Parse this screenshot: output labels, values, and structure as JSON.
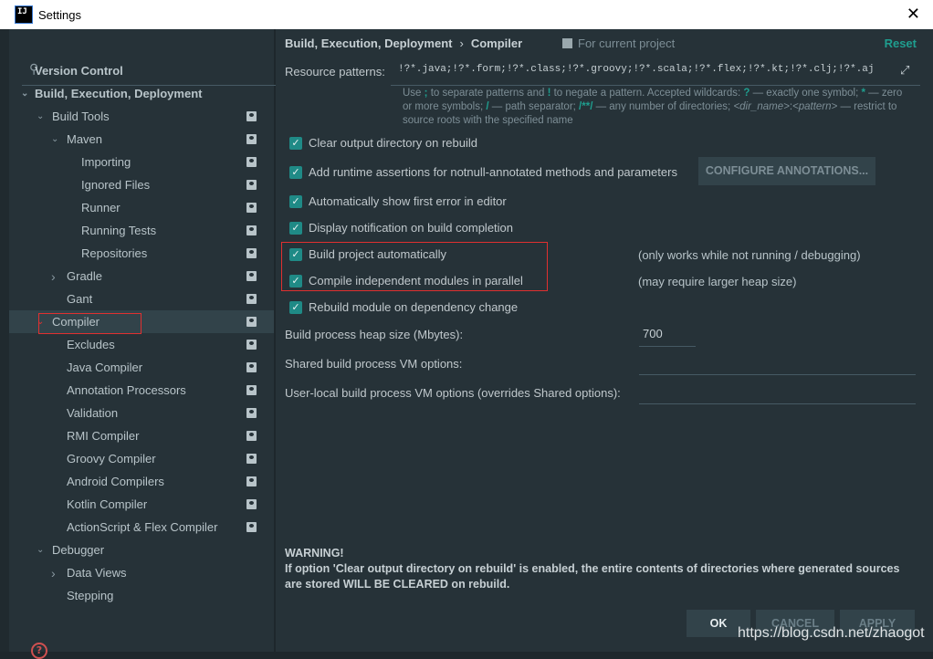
{
  "window": {
    "title": "Settings",
    "logo": "IJ"
  },
  "search": {
    "placeholder": ""
  },
  "tree": [
    {
      "label": "Version Control",
      "level": 0,
      "bold": true,
      "chevron": ""
    },
    {
      "label": "Build, Execution, Deployment",
      "level": 0,
      "bold": true,
      "chevron": "down"
    },
    {
      "label": "Build Tools",
      "level": 1,
      "chevron": "down",
      "proj": true
    },
    {
      "label": "Maven",
      "level": 2,
      "chevron": "down",
      "proj": true
    },
    {
      "label": "Importing",
      "level": 3,
      "proj": true
    },
    {
      "label": "Ignored Files",
      "level": 3,
      "proj": true
    },
    {
      "label": "Runner",
      "level": 3,
      "proj": true
    },
    {
      "label": "Running Tests",
      "level": 3,
      "proj": true
    },
    {
      "label": "Repositories",
      "level": 3,
      "proj": true
    },
    {
      "label": "Gradle",
      "level": 2,
      "chevron": "right",
      "proj": true
    },
    {
      "label": "Gant",
      "level": 2,
      "proj": true
    },
    {
      "label": "Compiler",
      "level": 1,
      "chevron": "down",
      "proj": true,
      "selected": true
    },
    {
      "label": "Excludes",
      "level": 2,
      "proj": true
    },
    {
      "label": "Java Compiler",
      "level": 2,
      "proj": true
    },
    {
      "label": "Annotation Processors",
      "level": 2,
      "proj": true
    },
    {
      "label": "Validation",
      "level": 2,
      "proj": true
    },
    {
      "label": "RMI Compiler",
      "level": 2,
      "proj": true
    },
    {
      "label": "Groovy Compiler",
      "level": 2,
      "proj": true
    },
    {
      "label": "Android Compilers",
      "level": 2,
      "proj": true
    },
    {
      "label": "Kotlin Compiler",
      "level": 2,
      "proj": true
    },
    {
      "label": "ActionScript & Flex Compiler",
      "level": 2,
      "proj": true
    },
    {
      "label": "Debugger",
      "level": 1,
      "chevron": "down"
    },
    {
      "label": "Data Views",
      "level": 2,
      "chevron": "right"
    },
    {
      "label": "Stepping",
      "level": 2
    }
  ],
  "header": {
    "breadcrumb_parent": "Build, Execution, Deployment",
    "breadcrumb_sep": "›",
    "breadcrumb_current": "Compiler",
    "scope": "For current project",
    "reset": "Reset"
  },
  "resource": {
    "label": "Resource patterns:",
    "value": "!?*.java;!?*.form;!?*.class;!?*.groovy;!?*.scala;!?*.flex;!?*.kt;!?*.clj;!?*.aj"
  },
  "hint": {
    "t1": "Use ",
    "k1": ";",
    "t2": " to separate patterns and ",
    "k2": "!",
    "t3": " to negate a pattern. Accepted wildcards: ",
    "k3": "?",
    "t4": " — exactly one symbol; ",
    "k4": "*",
    "t5": " — zero or more symbols; ",
    "k5": "/",
    "t6": " — path separator; ",
    "k6": "/**/",
    "t7": " — any number of directories; ",
    "i1": "<dir_name>",
    "t8": ":",
    "i2": "<pattern>",
    "t9": " — restrict to source roots with the specified name"
  },
  "options": [
    {
      "label": "Clear output directory on rebuild",
      "checked": true
    },
    {
      "label": "Add runtime assertions for notnull-annotated methods and parameters",
      "checked": true
    },
    {
      "label": "Automatically show first error in editor",
      "checked": true
    },
    {
      "label": "Display notification on build completion",
      "checked": true
    },
    {
      "label": "Build project automatically",
      "checked": true,
      "note": "(only works while not running / debugging)"
    },
    {
      "label": "Compile independent modules in parallel",
      "checked": true,
      "note": "(may require larger heap size)"
    },
    {
      "label": "Rebuild module on dependency change",
      "checked": true
    }
  ],
  "configure_annotations": "CONFIGURE ANNOTATIONS...",
  "heap": {
    "label": "Build process heap size (Mbytes):",
    "value": "700"
  },
  "shared_vm": {
    "label": "Shared build process VM options:",
    "value": ""
  },
  "local_vm": {
    "label": "User-local build process VM options (overrides Shared options):",
    "value": ""
  },
  "warning": {
    "title": "WARNING!",
    "text": "If option 'Clear output directory on rebuild' is enabled, the entire contents of directories where generated sources are stored WILL BE CLEARED on rebuild."
  },
  "buttons": {
    "ok": "OK",
    "cancel": "CANCEL",
    "apply": "APPLY"
  },
  "watermark": "https://blog.csdn.net/zhaogot",
  "colors": {
    "background": "#263238",
    "accent": "#1f8a86",
    "highlight": "#e03030"
  }
}
